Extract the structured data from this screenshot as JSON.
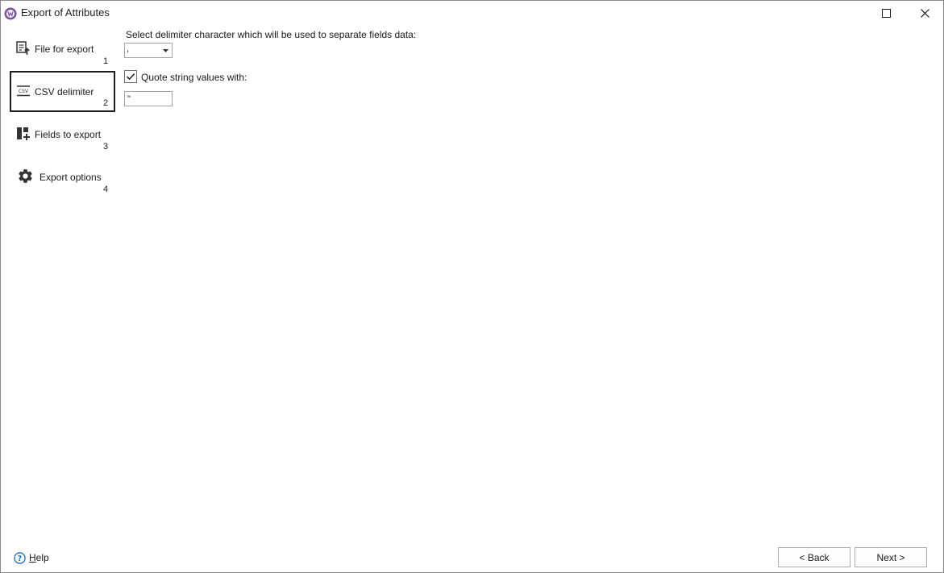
{
  "window": {
    "title": "Export of Attributes",
    "app_icon": "app-logo-icon",
    "maximize_icon": "maximize-icon",
    "close_icon": "close-icon"
  },
  "sidebar": {
    "items": [
      {
        "label": "File for export",
        "number": "1",
        "icon": "file-export-icon",
        "active": false
      },
      {
        "label": "CSV delimiter",
        "number": "2",
        "icon": "csv-icon",
        "active": true
      },
      {
        "label": "Fields to export",
        "number": "3",
        "icon": "fields-add-icon",
        "active": false
      },
      {
        "label": "Export options",
        "number": "4",
        "icon": "gear-icon",
        "active": false
      }
    ]
  },
  "main": {
    "delimiter_prompt": "Select delimiter character which will be used to separate fields data:",
    "delimiter_value": ",",
    "quote_checkbox_checked": true,
    "quote_label": "Quote string values with:",
    "quote_value": "\""
  },
  "footer": {
    "help_mnemonic": "H",
    "help_rest": "elp",
    "back_label": "< Back",
    "next_label": "Next >"
  },
  "colors": {
    "accent_purple": "#7b4fa0",
    "help_blue": "#1e6fbf",
    "active_border": "#1e1e1e"
  }
}
